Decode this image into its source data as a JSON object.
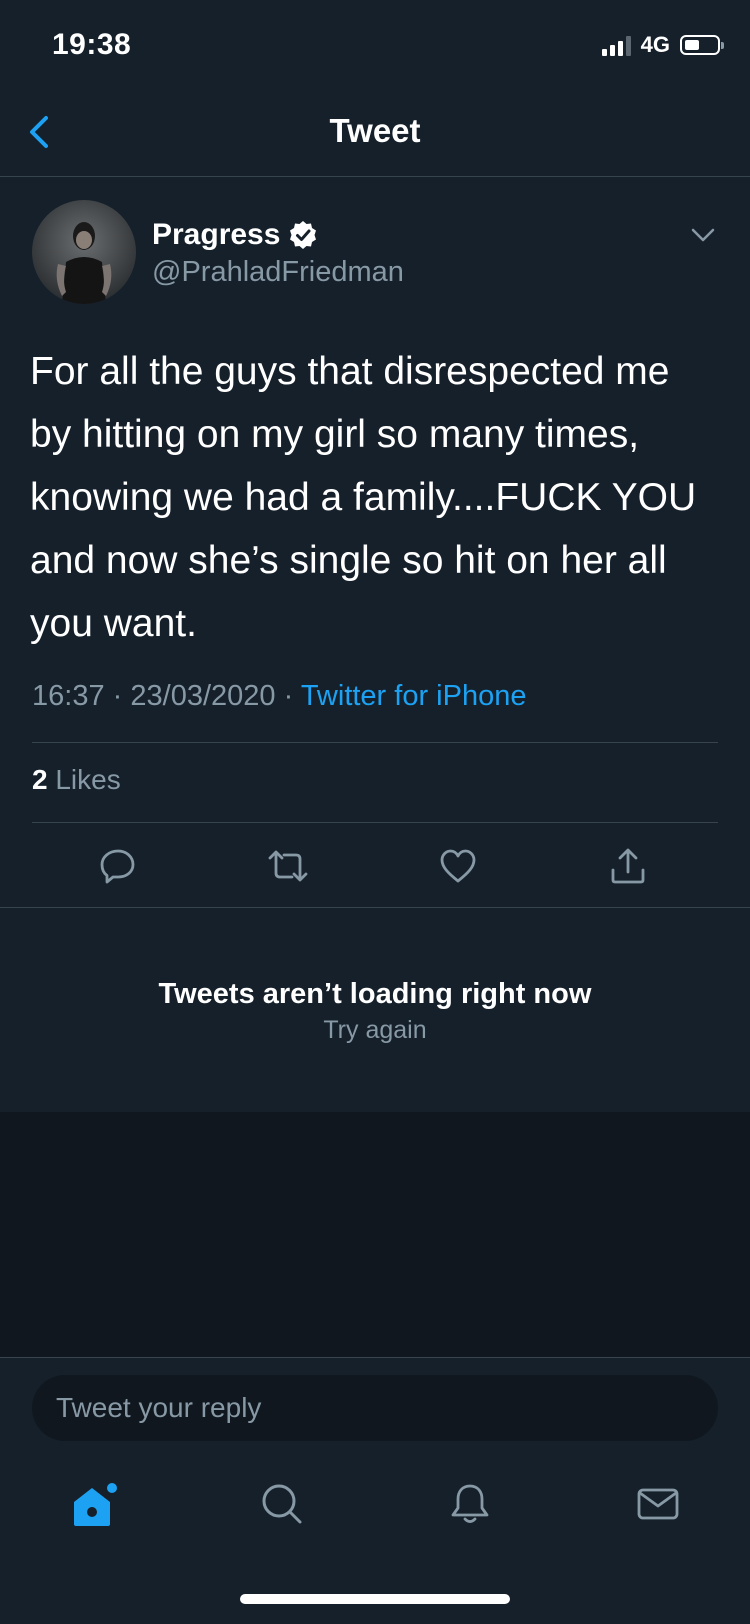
{
  "status_bar": {
    "time": "19:38",
    "network": "4G"
  },
  "nav": {
    "title": "Tweet"
  },
  "tweet": {
    "user_name": "Pragress",
    "user_handle": "@PrahladFriedman",
    "text": "For all the guys that disrespected me by hitting on my girl so many times, knowing we had a family....FUCK YOU and now she’s single so hit on her all you want.",
    "time": "16:37",
    "date": "23/03/2020",
    "separator": "·",
    "source": "Twitter for iPhone",
    "likes_count": "2",
    "likes_label": "Likes"
  },
  "timeline_error": {
    "title": "Tweets aren’t loading right now",
    "retry": "Try again"
  },
  "reply": {
    "placeholder": "Tweet your reply"
  },
  "icons": {
    "back": "chevron-left-icon",
    "more": "chevron-down-icon",
    "verified": "verified-badge-icon",
    "actions": [
      "reply-icon",
      "retweet-icon",
      "like-icon",
      "share-icon"
    ],
    "tabs": [
      "home-icon",
      "search-icon",
      "notifications-icon",
      "messages-icon"
    ]
  },
  "colors": {
    "background": "#15202b",
    "accent": "#1da1f2",
    "muted": "#8899a6",
    "divider": "#38444d"
  }
}
